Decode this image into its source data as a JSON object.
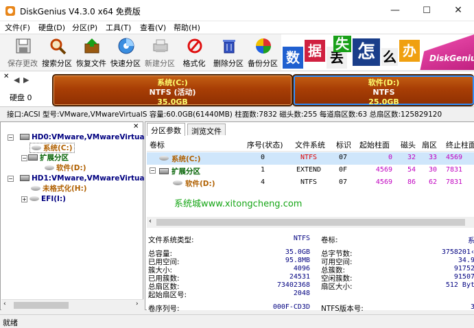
{
  "window": {
    "title": "DiskGenius V4.3.0 x64 免费版",
    "minimize": "—",
    "maximize": "☐",
    "close": "✕"
  },
  "menu": [
    "文件(F)",
    "硬盘(D)",
    "分区(P)",
    "工具(T)",
    "查看(V)",
    "帮助(H)"
  ],
  "toolbar": [
    {
      "label": "保存更改",
      "icon": "save-icon"
    },
    {
      "label": "搜索分区",
      "icon": "magnifier-icon"
    },
    {
      "label": "恢复文件",
      "icon": "recover-box-icon"
    },
    {
      "label": "快速分区",
      "icon": "disc-icon"
    },
    {
      "label": "新建分区",
      "icon": "printer-icon"
    },
    {
      "label": "格式化",
      "icon": "prohibit-icon"
    },
    {
      "label": "删除分区",
      "icon": "trash-icon"
    },
    {
      "label": "备份分区",
      "icon": "color-ball-icon"
    }
  ],
  "banner": {
    "chars": [
      "数",
      "据",
      "丢",
      "失",
      "怎",
      "么",
      "办"
    ],
    "brand": "DiskGenius"
  },
  "disk_strip": {
    "label": "硬盘 0",
    "partitions": [
      {
        "name": "系统(C:)",
        "fs": "NTFS (活动)",
        "size": "35.0GB"
      },
      {
        "name": "软件(D:)",
        "fs": "NTFS",
        "size": "25.0GB"
      }
    ]
  },
  "disk_info": "接口:ACSI  型号:VMware,VMwareVirtualS  容量:60.0GB(61440MB)  柱面数:7832  磁头数:255  每道扇区数:63  总扇区数:125829120",
  "tree": [
    {
      "text": "HD0:VMware,VMwareVirtualS",
      "color": "#000080",
      "kind": "disk",
      "exp": "−"
    },
    {
      "text": "系统(C:)",
      "color": "#b06000",
      "kind": "part",
      "selected": true
    },
    {
      "text": "扩展分区",
      "color": "#006000",
      "kind": "disk",
      "exp": "−"
    },
    {
      "text": "软件(D:)",
      "color": "#b06000",
      "kind": "part"
    },
    {
      "text": "HD1:VMware,VMwareVirtualS",
      "color": "#000080",
      "kind": "disk",
      "exp": "−"
    },
    {
      "text": "未格式化(H:)",
      "color": "#b06000",
      "kind": "part"
    },
    {
      "text": "EFI(I:)",
      "color": "#000080",
      "kind": "part",
      "exp": "+"
    }
  ],
  "tabs": [
    "分区参数",
    "浏览文件"
  ],
  "table": {
    "headers": [
      "卷标",
      "序号(状态)",
      "文件系统",
      "标识",
      "起始柱面",
      "磁头",
      "扇区",
      "终止柱面"
    ],
    "rows": [
      [
        "系统(C:)",
        "0",
        "NTFS",
        "07",
        "0",
        "32",
        "33",
        "4569"
      ],
      [
        "扩展分区",
        "1",
        "EXTEND",
        "0F",
        "4569",
        "54",
        "30",
        "7831"
      ],
      [
        "软件(D:)",
        "4",
        "NTFS",
        "07",
        "4569",
        "86",
        "62",
        "7831"
      ]
    ]
  },
  "watermark": "系统城www.xitongcheng.com",
  "details": {
    "fs_type_label": "文件系统类型:",
    "fs_type_value": "NTFS",
    "volume_label": "卷标:",
    "volume_value": "系",
    "left": [
      {
        "k": "总容量:",
        "v": "35.0GB"
      },
      {
        "k": "已用空间:",
        "v": "95.8MB"
      },
      {
        "k": "簇大小:",
        "v": "4096"
      },
      {
        "k": "已用簇数:",
        "v": "24531"
      },
      {
        "k": "总扇区数:",
        "v": "73402368"
      },
      {
        "k": "起始扇区号:",
        "v": "2048"
      }
    ],
    "right": [
      {
        "k": "总字节数:",
        "v": "3758201‹"
      },
      {
        "k": "可用空间:",
        "v": "34.9"
      },
      {
        "k": "总簇数:",
        "v": "91752"
      },
      {
        "k": "空闲簇数:",
        "v": "91507"
      },
      {
        "k": "扇区大小:",
        "v": "512 Byt"
      }
    ],
    "serial_label": "卷序列号:",
    "serial_value": "000F-CD3D",
    "ntfs_ver_label": "NTFS版本号:",
    "ntfs_ver_value": "3"
  },
  "status": "就绪"
}
